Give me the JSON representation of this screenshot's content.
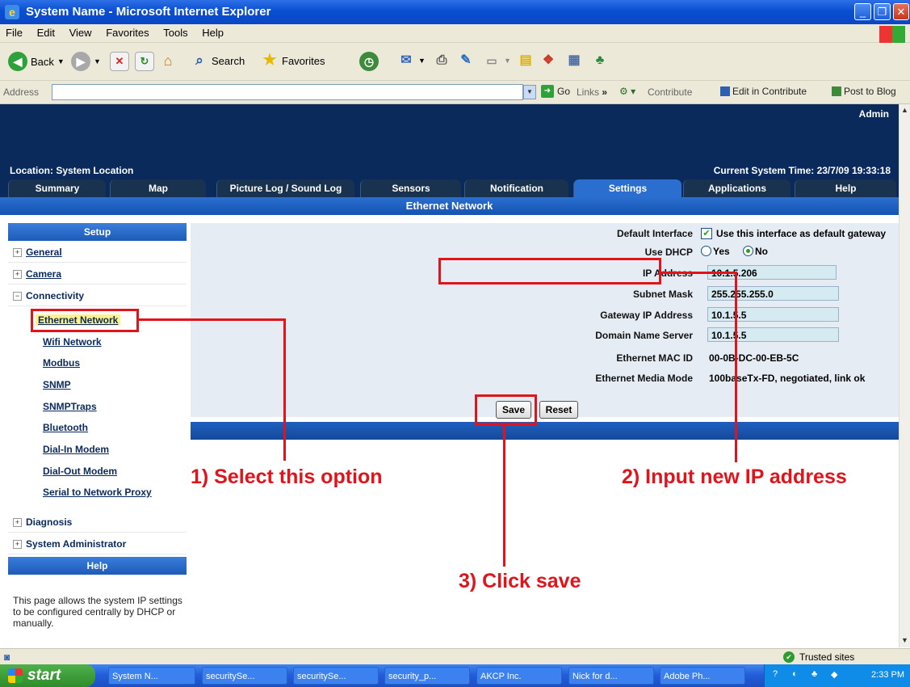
{
  "window": {
    "title": "System Name - Microsoft Internet Explorer"
  },
  "menu": [
    "File",
    "Edit",
    "View",
    "Favorites",
    "Tools",
    "Help"
  ],
  "toolbar": {
    "back": "Back",
    "search": "Search",
    "favorites": "Favorites"
  },
  "addressbar": {
    "label": "Address",
    "go": "Go",
    "links": "Links",
    "contribute": "Contribute",
    "edit_in_contribute": "Edit in Contribute",
    "post_to_blog": "Post to Blog"
  },
  "header": {
    "user": "Admin",
    "location": "Location: System Location",
    "time": "Current System Time: 23/7/09 19:33:18"
  },
  "tabs": [
    "Summary",
    "Map",
    "Picture Log / Sound Log",
    "Sensors",
    "Notification",
    "Settings",
    "Applications",
    "Help"
  ],
  "page_title": "Ethernet Network",
  "sidebar": {
    "setup_title": "Setup",
    "groups": [
      "General",
      "Camera",
      "Connectivity",
      "Diagnosis",
      "System Administrator"
    ],
    "connectivity_items": [
      "Ethernet Network",
      "Wifi Network",
      "Modbus",
      "SNMP",
      "SNMPTraps",
      "Bluetooth",
      "Dial-In Modem",
      "Dial-Out Modem",
      "Serial to Network Proxy"
    ],
    "help_title": "Help",
    "help_text": "This page allows the system IP settings to be configured centrally by DHCP or manually."
  },
  "form": {
    "default_interface_label": "Default Interface",
    "default_interface_text": "Use this interface as default gateway",
    "default_interface_checked": true,
    "dhcp_label": "Use DHCP",
    "dhcp_yes": "Yes",
    "dhcp_no": "No",
    "dhcp_selected": "No",
    "ip_label": "IP Address",
    "ip_value": "10.1.5.206",
    "subnet_label": "Subnet Mask",
    "subnet_value": "255.255.255.0",
    "gateway_label": "Gateway IP Address",
    "gateway_value": "10.1.5.5",
    "dns_label": "Domain Name Server",
    "dns_value": "10.1.5.5",
    "mac_label": "Ethernet MAC ID",
    "mac_value": "00-0B-DC-00-EB-5C",
    "media_label": "Ethernet Media Mode",
    "media_value": "100baseTx-FD, negotiated, link ok",
    "save": "Save",
    "reset": "Reset"
  },
  "annotations": {
    "step1": "1) Select this option",
    "step2": "2) Input new IP address",
    "step3": "3) Click save"
  },
  "statusbar": {
    "zone": "Trusted sites"
  },
  "taskbar": {
    "start": "start",
    "items": [
      "System N...",
      "securitySe...",
      "securitySe...",
      "security_p...",
      "AKCP Inc.",
      "Nick for d...",
      "Adobe Ph..."
    ],
    "clock": "2:33 PM"
  },
  "colors": {
    "accent": "#2a6ed0",
    "header": "#0a2a5c",
    "annotation": "#e1141c"
  }
}
